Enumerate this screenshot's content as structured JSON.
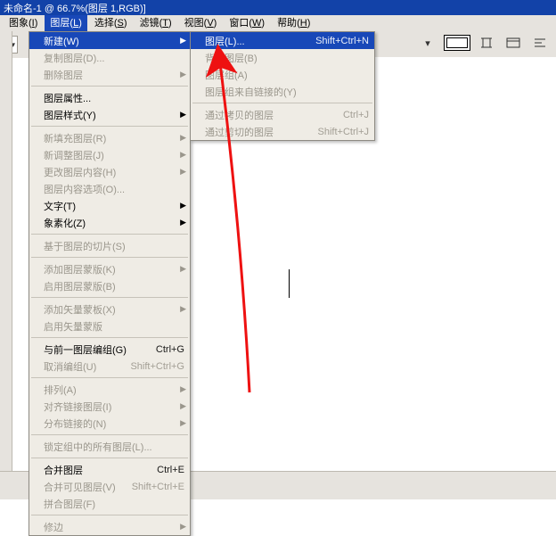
{
  "title": "未命名-1 @ 66.7%(图层 1,RGB)]",
  "menu_bar": {
    "image": {
      "label": "图象",
      "key": "I"
    },
    "layer": {
      "label": "图层",
      "key": "L"
    },
    "select": {
      "label": "选择",
      "key": "S"
    },
    "filter": {
      "label": "滤镜",
      "key": "T"
    },
    "view": {
      "label": "视图",
      "key": "V"
    },
    "window": {
      "label": "窗口",
      "key": "W"
    },
    "help": {
      "label": "帮助",
      "key": "H"
    }
  },
  "layer_menu": {
    "new": {
      "label": "新建(W)"
    },
    "duplicate": {
      "label": "复制图层(D)..."
    },
    "delete": {
      "label": "删除图层"
    },
    "properties": {
      "label": "图层属性..."
    },
    "style": {
      "label": "图层样式(Y)"
    },
    "new_fill": {
      "label": "新填充图层(R)"
    },
    "new_adjust": {
      "label": "新调整图层(J)"
    },
    "change_content": {
      "label": "更改图层内容(H)"
    },
    "content_opts": {
      "label": "图层内容选项(O)..."
    },
    "type": {
      "label": "文字(T)"
    },
    "rasterize": {
      "label": "象素化(Z)"
    },
    "slice": {
      "label": "基于图层的切片(S)"
    },
    "add_mask": {
      "label": "添加图层蒙版(K)"
    },
    "enable_mask": {
      "label": "启用图层蒙版(B)"
    },
    "add_vmask": {
      "label": "添加矢量蒙板(X)"
    },
    "enable_vmask": {
      "label": "启用矢量蒙版"
    },
    "group_prev": {
      "label": "与前一图层编组(G)",
      "accel": "Ctrl+G"
    },
    "ungroup": {
      "label": "取消编组(U)",
      "accel": "Shift+Ctrl+G"
    },
    "arrange": {
      "label": "排列(A)"
    },
    "align_linked": {
      "label": "对齐链接图层(I)"
    },
    "dist_linked": {
      "label": "分布链接的(N)"
    },
    "lock_all": {
      "label": "锁定组中的所有图层(L)..."
    },
    "merge": {
      "label": "合并图层",
      "accel": "Ctrl+E"
    },
    "merge_visible": {
      "label": "合并可见图层(V)",
      "accel": "Shift+Ctrl+E"
    },
    "flatten": {
      "label": "拼合图层(F)"
    },
    "matting": {
      "label": "修边"
    }
  },
  "new_submenu": {
    "layer": {
      "label": "图层(L)...",
      "accel": "Shift+Ctrl+N"
    },
    "background": {
      "label": "背景图层(B)"
    },
    "layer_set": {
      "label": "图层组(A)"
    },
    "set_from_linked": {
      "label": "图层组来自链接的(Y)"
    },
    "via_copy": {
      "label": "通过拷贝的图层",
      "accel": "Ctrl+J"
    },
    "via_cut": {
      "label": "通过剪切的图层",
      "accel": "Shift+Ctrl+J"
    }
  },
  "arrow_caption": "",
  "colors": {
    "accent": "#1848b8",
    "titlebar": "#1242a8",
    "chrome": "#e6e3de"
  }
}
